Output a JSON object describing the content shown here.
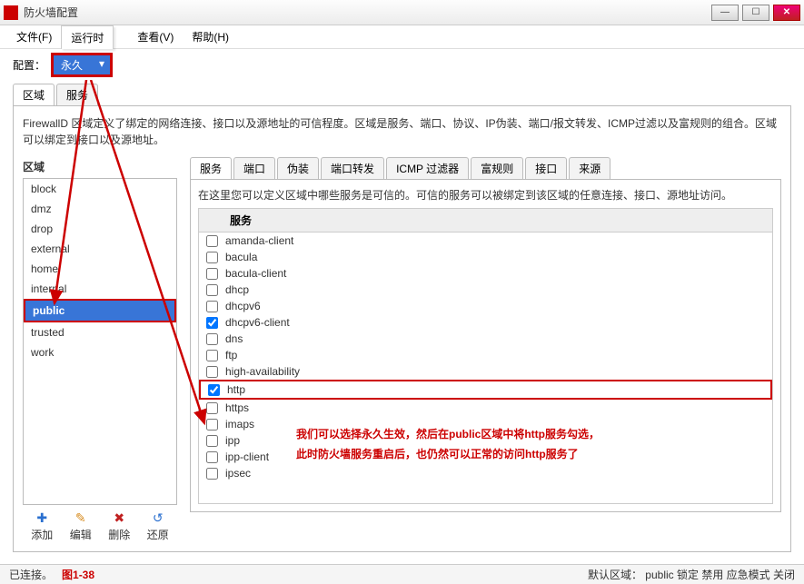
{
  "window": {
    "title": "防火墙配置"
  },
  "menu": {
    "file": "文件(F)",
    "runtime": "运行时",
    "view": "查看(V)",
    "help": "帮助(H)"
  },
  "config": {
    "label": "配置：",
    "value": "永久"
  },
  "maintabs": {
    "zones": "区域",
    "services": "服务"
  },
  "desc": "FirewallD 区域定义了绑定的网络连接、接口以及源地址的可信程度。区域是服务、端口、协议、IP伪装、端口/报文转发、ICMP过滤以及富规则的组合。区域可以绑定到接口以及源地址。",
  "left": {
    "heading": "区域",
    "items": [
      "block",
      "dmz",
      "drop",
      "external",
      "home",
      "internal",
      "public",
      "trusted",
      "work"
    ],
    "selected": "public",
    "toolbar": {
      "add": "添加",
      "edit": "编辑",
      "delete": "删除",
      "restore": "还原"
    },
    "icons": {
      "add": "✚",
      "edit": "✎",
      "delete": "✖",
      "restore": "↺"
    },
    "colors": {
      "add": "#2a6fcf",
      "edit": "#d78b1e",
      "delete": "#c02020",
      "restore": "#2a6fcf"
    }
  },
  "subtabs": [
    "服务",
    "端口",
    "伪装",
    "端口转发",
    "ICMP 过滤器",
    "富规则",
    "接口",
    "来源"
  ],
  "subtab_active": "服务",
  "svcdesc": "在这里您可以定义区域中哪些服务是可信的。可信的服务可以被绑定到该区域的任意连接、接口、源地址访问。",
  "svcheader": "服务",
  "services": [
    {
      "name": "amanda-client",
      "checked": false
    },
    {
      "name": "bacula",
      "checked": false
    },
    {
      "name": "bacula-client",
      "checked": false
    },
    {
      "name": "dhcp",
      "checked": false
    },
    {
      "name": "dhcpv6",
      "checked": false
    },
    {
      "name": "dhcpv6-client",
      "checked": true
    },
    {
      "name": "dns",
      "checked": false
    },
    {
      "name": "ftp",
      "checked": false
    },
    {
      "name": "high-availability",
      "checked": false
    },
    {
      "name": "http",
      "checked": true,
      "highlight": true
    },
    {
      "name": "https",
      "checked": false
    },
    {
      "name": "imaps",
      "checked": false
    },
    {
      "name": "ipp",
      "checked": false
    },
    {
      "name": "ipp-client",
      "checked": false
    },
    {
      "name": "ipsec",
      "checked": false
    }
  ],
  "annot": {
    "line1": "我们可以选择永久生效，然后在public区域中将http服务勾选，",
    "line2": "此时防火墙服务重启后，也仍然可以正常的访问http服务了"
  },
  "status": {
    "left": "已连接。",
    "fig": "图1-38",
    "right": "默认区域： public 锁定 禁用 应急模式 关闭"
  }
}
